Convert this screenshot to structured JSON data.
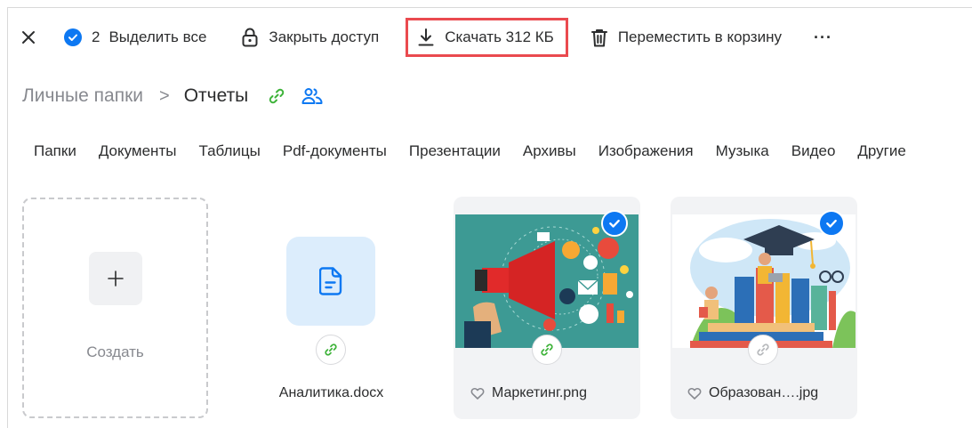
{
  "toolbar": {
    "selected_count": "2",
    "select_all_label": "Выделить все",
    "close_access_label": "Закрыть доступ",
    "download_label": "Скачать 312 КБ",
    "trash_label": "Переместить в корзину",
    "more_label": "···"
  },
  "breadcrumb": {
    "parent": "Личные папки",
    "separator": ">",
    "current": "Отчеты"
  },
  "filters": [
    "Папки",
    "Документы",
    "Таблицы",
    "Pdf-документы",
    "Презентации",
    "Архивы",
    "Изображения",
    "Музыка",
    "Видео",
    "Другие"
  ],
  "tiles": {
    "create_label": "Создать",
    "doc_name": "Аналитика.docx",
    "image1_name": "Маркетинг.png",
    "image2_name": "Образован….jpg"
  },
  "colors": {
    "accent_blue": "#0d78f2",
    "link_green": "#3eb33a",
    "highlight_red": "#ea4a4f",
    "doc_tile_bg": "#dcedfc"
  }
}
